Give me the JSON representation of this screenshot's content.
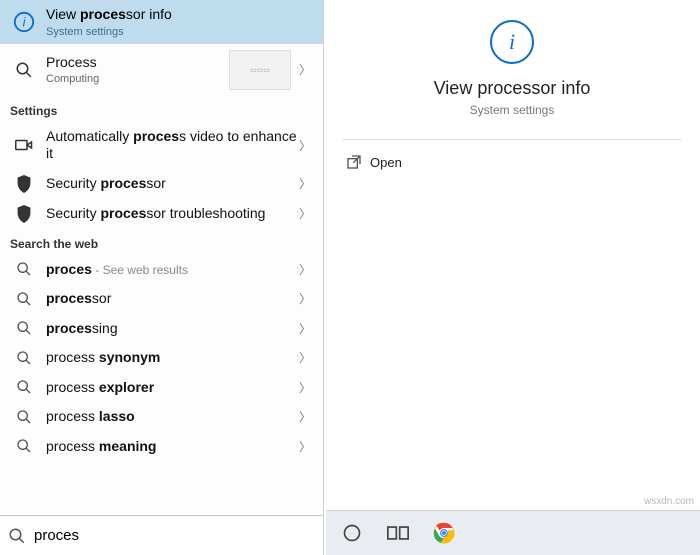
{
  "best_match": {
    "title_pre": "View ",
    "title_bold": "proces",
    "title_post": "sor info",
    "subtitle": "System settings"
  },
  "second": {
    "title": "Process",
    "subtitle": "Computing"
  },
  "sections": {
    "settings_header": "Settings",
    "web_header": "Search the web"
  },
  "settings_items": [
    {
      "pre": "Automatically ",
      "bold": "proces",
      "post": "s video to enhance it",
      "icon": "video"
    },
    {
      "pre": "Security ",
      "bold": "proces",
      "post": "sor",
      "icon": "shield"
    },
    {
      "pre": "Security ",
      "bold": "proces",
      "post": "sor troubleshooting",
      "icon": "shield"
    }
  ],
  "web_items": [
    {
      "pre": "",
      "bold": "proces",
      "post": "",
      "tail": " - See web results"
    },
    {
      "pre": "",
      "bold": "proces",
      "post": "sor",
      "tail": ""
    },
    {
      "pre": "",
      "bold": "proces",
      "post": "sing",
      "tail": ""
    },
    {
      "pre": "process ",
      "bold": "synonym",
      "post": "",
      "tail": ""
    },
    {
      "pre": "process ",
      "bold": "explorer",
      "post": "",
      "tail": ""
    },
    {
      "pre": "process ",
      "bold": "lasso",
      "post": "",
      "tail": ""
    },
    {
      "pre": "process ",
      "bold": "meaning",
      "post": "",
      "tail": ""
    }
  ],
  "search": {
    "value": "proces"
  },
  "detail": {
    "title": "View processor info",
    "subtitle": "System settings",
    "open_label": "Open"
  },
  "watermark": "wsxdn.com"
}
